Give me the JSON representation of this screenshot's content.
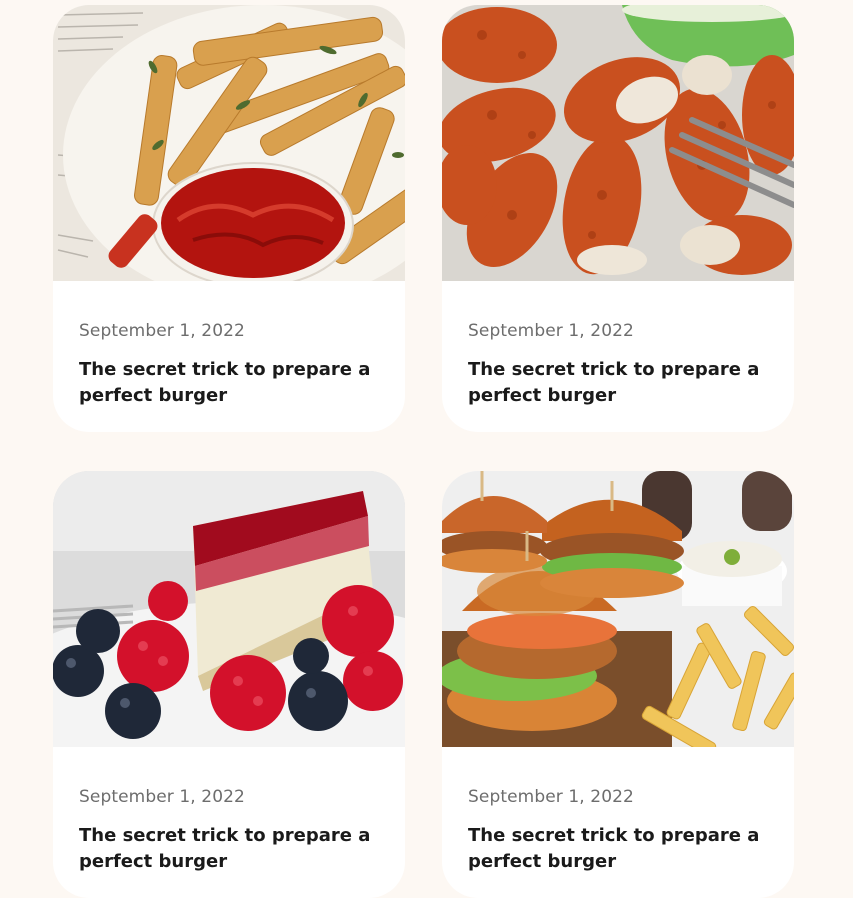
{
  "cards": [
    {
      "image": "fries-with-ketchup",
      "date": "September 1, 2022",
      "title": "The secret trick to prepare a perfect burger"
    },
    {
      "image": "fried-chicken-tenders",
      "date": "September 1, 2022",
      "title": "The secret trick to prepare a perfect burger"
    },
    {
      "image": "raspberry-cheesecake",
      "date": "September 1, 2022",
      "title": "The secret trick to prepare a perfect burger"
    },
    {
      "image": "chicken-burgers-with-fries",
      "date": "September 1, 2022",
      "title": "The secret trick to prepare a perfect burger"
    }
  ],
  "colors": {
    "page_background": "#fdf8f3",
    "card_background": "#ffffff",
    "date_text": "#6d6d6d",
    "title_text": "#1a1a1a"
  }
}
